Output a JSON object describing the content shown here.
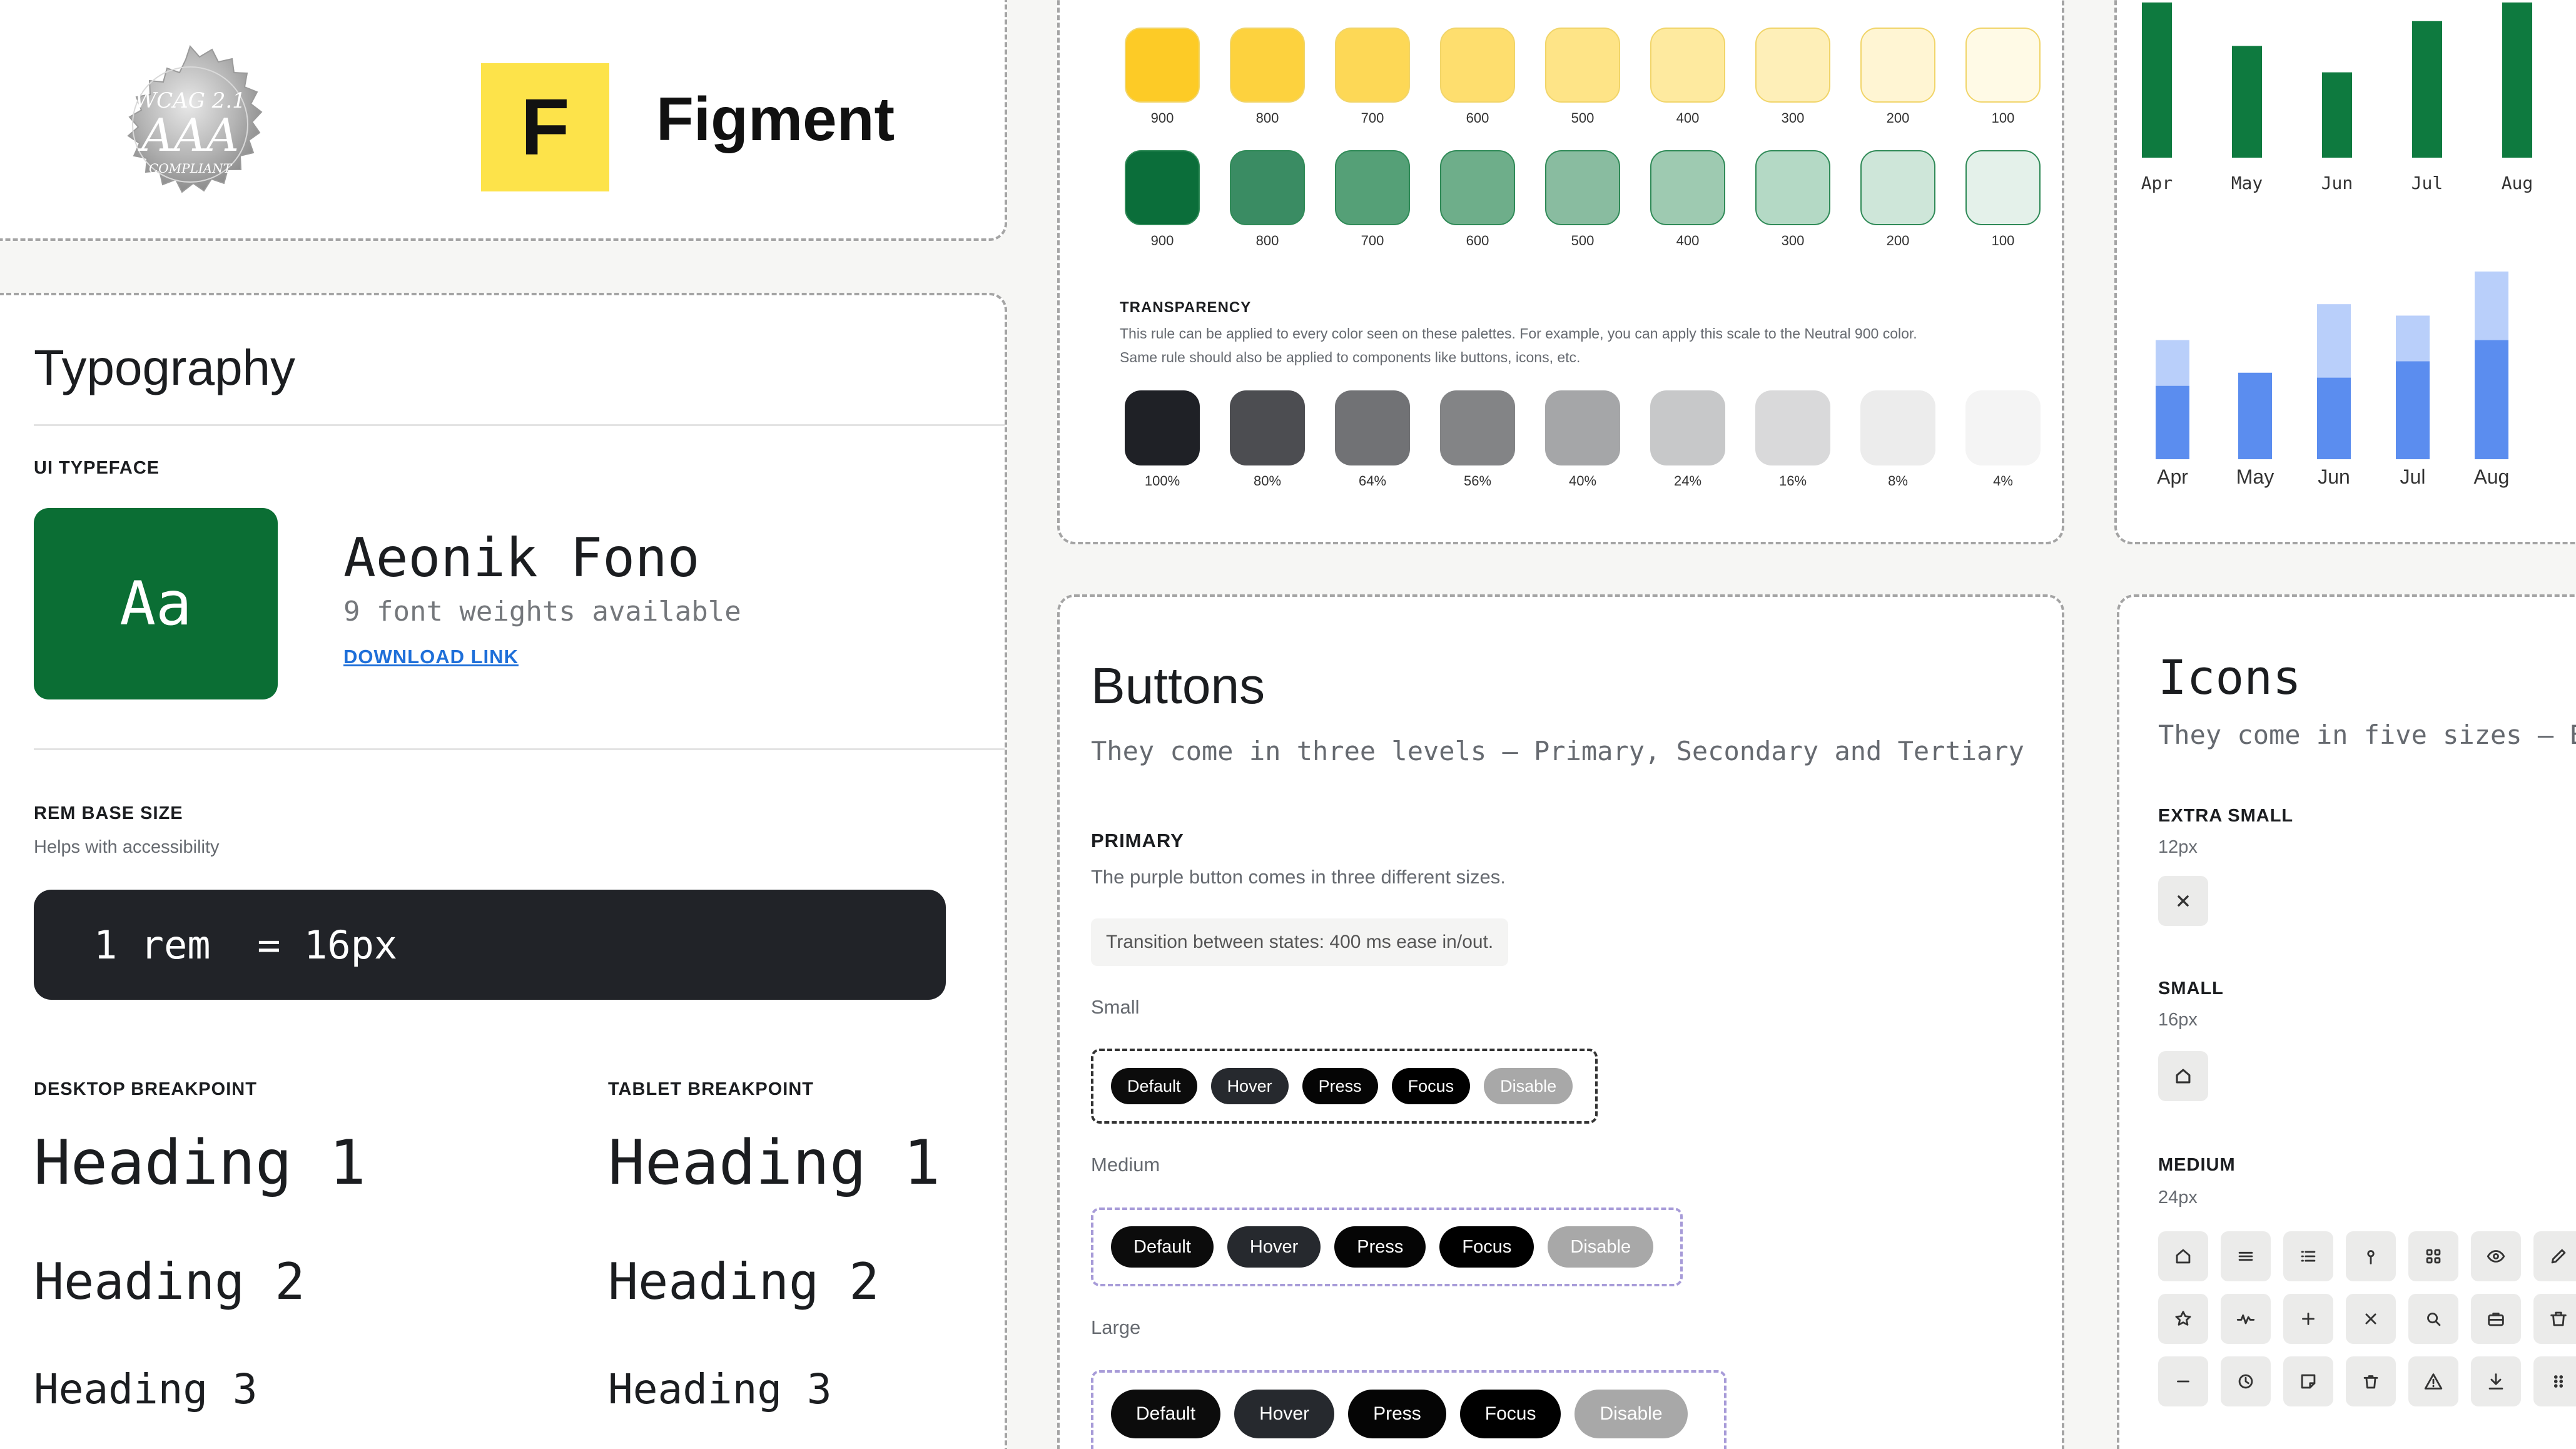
{
  "logo": {
    "badge_line1": "WCAG 2.1",
    "badge_line2": "AAA",
    "badge_line3": "COMPLIANT",
    "brand_letter": "F",
    "brand_name": "Figment"
  },
  "typography": {
    "title": "Typography",
    "ui_typeface_label": "UI TYPEFACE",
    "sample": "Aa",
    "font_name": "Aeonik Fono",
    "weights_text": "9 font weights available",
    "download_link": "DOWNLOAD LINK",
    "rem_label": "REM BASE SIZE",
    "rem_sub": "Helps with accessibility",
    "rem_value": "1 rem  = 16px",
    "desktop_label": "DESKTOP BREAKPOINT",
    "tablet_label": "TABLET BREAKPOINT",
    "desktop_headings": [
      "Heading 1",
      "Heading 2",
      "Heading 3"
    ],
    "tablet_headings": [
      "Heading 1",
      "Heading 2",
      "Heading 3"
    ]
  },
  "colors": {
    "yellow": [
      {
        "label": "900",
        "hex": "#FDCB26"
      },
      {
        "label": "800",
        "hex": "#FDD23E"
      },
      {
        "label": "700",
        "hex": "#FDD856"
      },
      {
        "label": "600",
        "hex": "#FEDE6E"
      },
      {
        "label": "500",
        "hex": "#FEE487"
      },
      {
        "label": "400",
        "hex": "#FEEA9F"
      },
      {
        "label": "300",
        "hex": "#FEEFB8"
      },
      {
        "label": "200",
        "hex": "#FFF5D3"
      },
      {
        "label": "100",
        "hex": "#FFFAE6"
      }
    ],
    "green": [
      {
        "label": "900",
        "hex": "#0B6E3A"
      },
      {
        "label": "800",
        "hex": "#3A8C63"
      },
      {
        "label": "700",
        "hex": "#55A077"
      },
      {
        "label": "600",
        "hex": "#6EAE8A"
      },
      {
        "label": "500",
        "hex": "#89BCA0"
      },
      {
        "label": "400",
        "hex": "#9ECAB1"
      },
      {
        "label": "300",
        "hex": "#B4D9C5"
      },
      {
        "label": "200",
        "hex": "#CEE6D9"
      },
      {
        "label": "100",
        "hex": "#E4F1EA"
      }
    ],
    "transparency_label": "TRANSPARENCY",
    "transparency_text1": "This rule can be applied to every color seen on these palettes. For example, you can apply this scale to the Neutral 900 color.",
    "transparency_text2": "Same rule should also be applied to components like buttons, icons, etc.",
    "neutral": [
      {
        "label": "100%",
        "hex": "#1F2126"
      },
      {
        "label": "80%",
        "hex": "#4C4D51"
      },
      {
        "label": "64%",
        "hex": "#717275"
      },
      {
        "label": "56%",
        "hex": "#838486"
      },
      {
        "label": "40%",
        "hex": "#A5A6A8"
      },
      {
        "label": "24%",
        "hex": "#C7C8C9"
      },
      {
        "label": "16%",
        "hex": "#D9D9DA"
      },
      {
        "label": "8%",
        "hex": "#ECECEC"
      },
      {
        "label": "4%",
        "hex": "#F4F4F4"
      }
    ]
  },
  "chart_data": [
    {
      "type": "bar",
      "categories": [
        "Apr",
        "May",
        "Jun",
        "Jul",
        "Aug"
      ],
      "values": [
        100,
        72,
        55,
        88,
        100
      ],
      "ylim": [
        0,
        100
      ],
      "colors": [
        "#0E7A3F"
      ]
    },
    {
      "type": "bar",
      "stacked": true,
      "categories": [
        "Apr",
        "May",
        "Jun",
        "Jul",
        "Aug"
      ],
      "series": [
        {
          "values": [
            45,
            53,
            50,
            60,
            73
          ],
          "color": "#5B8DEF"
        },
        {
          "values": [
            28,
            0,
            45,
            28,
            42
          ],
          "color": "#B9CFFA"
        }
      ],
      "ylim": [
        0,
        115
      ]
    }
  ],
  "buttons": {
    "title": "Buttons",
    "subtitle": "They come in three levels — Primary, Secondary and Tertiary",
    "primary_label": "PRIMARY",
    "primary_desc": "The purple button comes in three different sizes.",
    "transition_note": "Transition between states: 400 ms ease in/out.",
    "size_small": "Small",
    "size_medium": "Medium",
    "size_large": "Large",
    "states": [
      "Default",
      "Hover",
      "Press",
      "Focus",
      "Disable"
    ]
  },
  "icons": {
    "title": "Icons",
    "subtitle": "They come in five sizes — Extra",
    "xs_label": "EXTRA SMALL",
    "xs_size": "12px",
    "sm_label": "SMALL",
    "sm_size": "16px",
    "md_label": "MEDIUM",
    "md_size": "24px",
    "xs_icon": "close-icon",
    "sm_icon": "home-icon",
    "md_icons": [
      [
        "home-icon",
        "menu-icon",
        "list-icon",
        "map-pin-icon",
        "grid-icon",
        "eye-icon",
        "edit-icon"
      ],
      [
        "star-icon",
        "activity-icon",
        "plus-icon",
        "close-icon",
        "search-icon",
        "briefcase-icon",
        "trash-icon"
      ],
      [
        "minus-icon",
        "clock-icon",
        "note-icon",
        "delete-icon",
        "alert-icon",
        "download-icon",
        "drag-icon"
      ]
    ]
  }
}
